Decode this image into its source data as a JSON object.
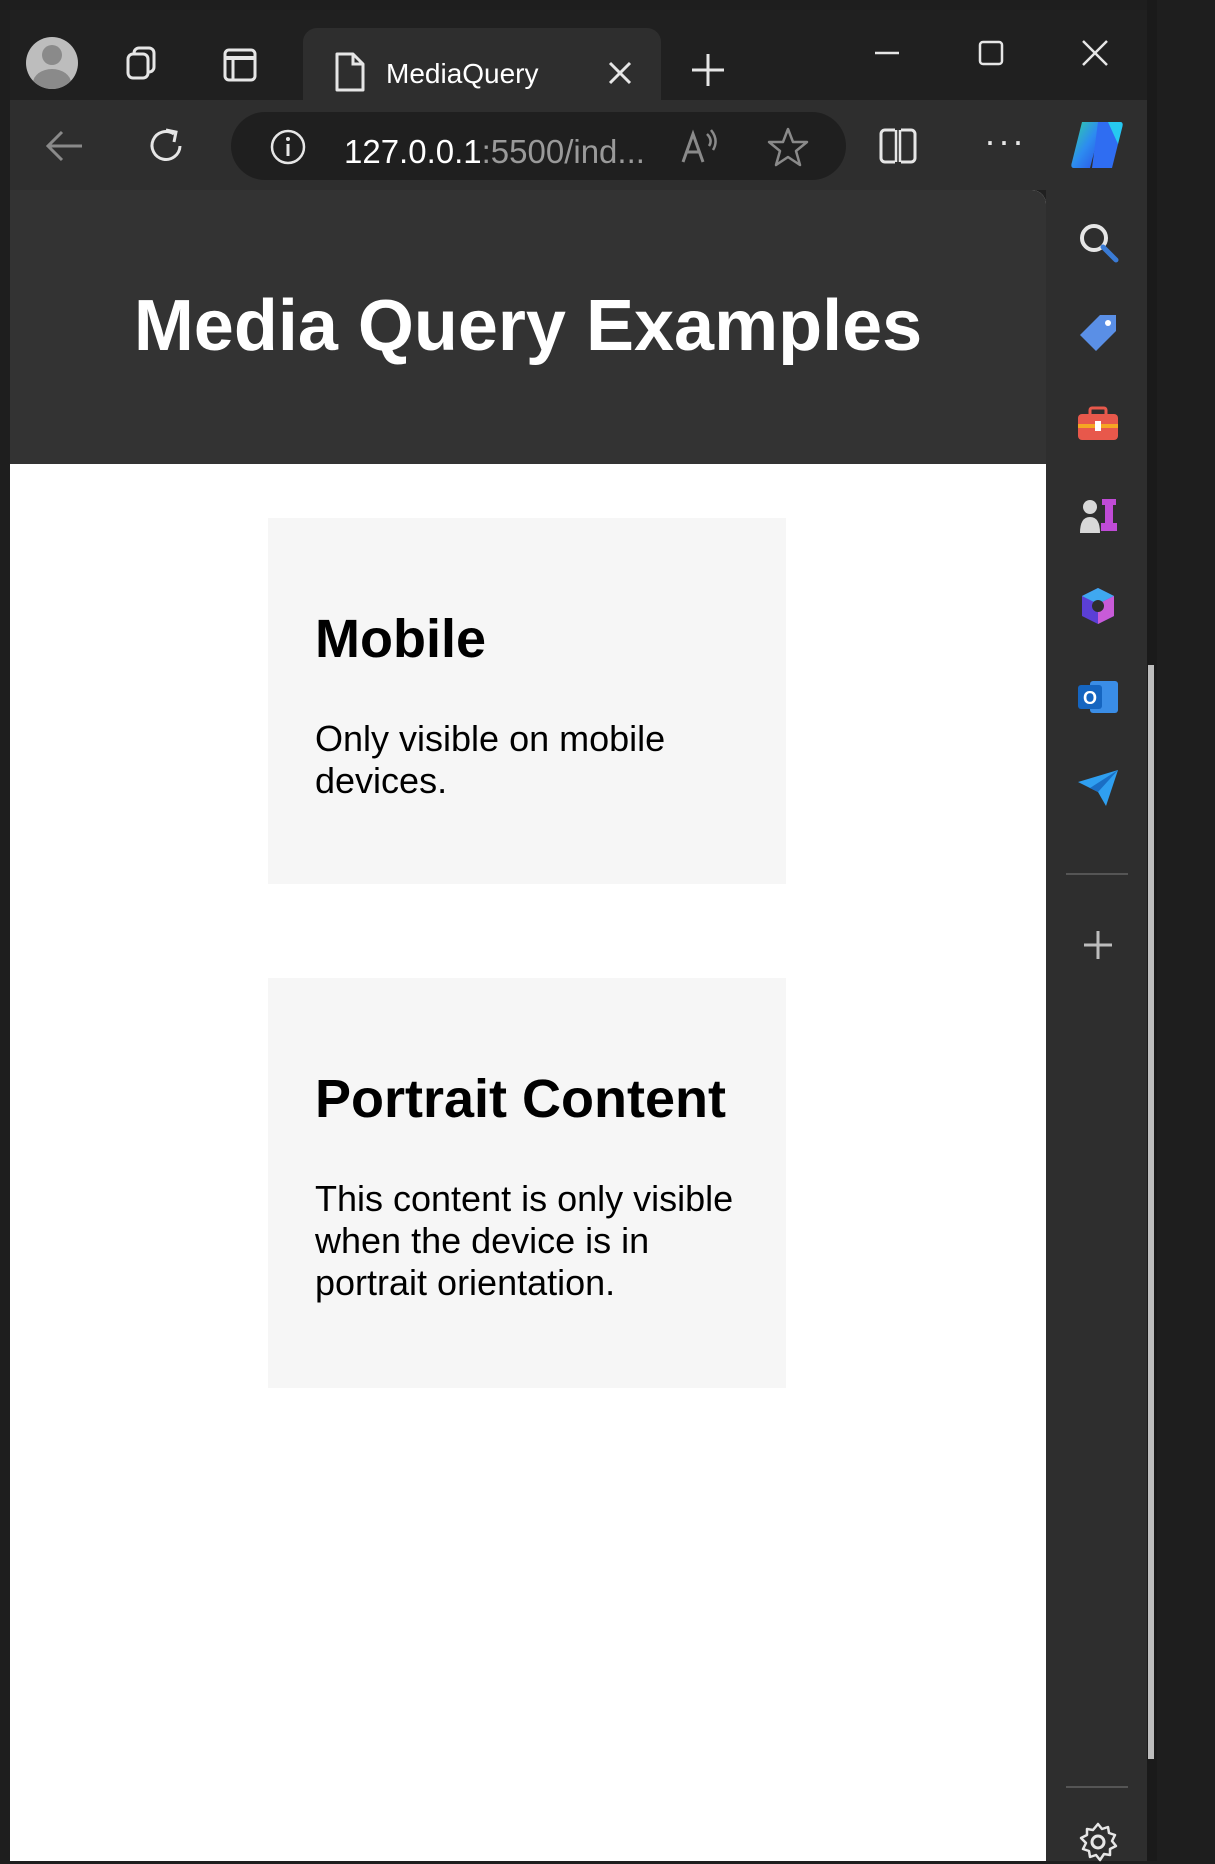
{
  "tab": {
    "title": "MediaQuery"
  },
  "address_bar": {
    "url_host": "127.0.0.1",
    "url_rest": ":5500/ind..."
  },
  "page": {
    "title": "Media Query Examples",
    "cards": [
      {
        "heading": "Mobile",
        "text": "Only visible on mobile devices."
      },
      {
        "heading": "Portrait Content",
        "text": "This content is only visible when the device is in portrait orientation."
      }
    ]
  },
  "colors": {
    "header_bg": "#333333",
    "card_bg": "#f6f6f6",
    "browser_chrome": "#2e2e2e"
  },
  "icons": {
    "tabbar": [
      "profile-avatar",
      "workspaces-icon",
      "tab-actions-icon",
      "page-icon",
      "close-icon",
      "new-tab-icon",
      "minimize-icon",
      "maximize-icon",
      "window-close-icon"
    ],
    "toolbar": [
      "back-icon",
      "refresh-icon",
      "info-icon",
      "read-aloud-icon",
      "favorite-star-icon",
      "split-screen-icon",
      "more-icon",
      "copilot-icon"
    ],
    "sidebar": [
      "search-icon",
      "shopping-tag-icon",
      "tools-icon",
      "games-icon",
      "microsoft365-icon",
      "outlook-icon",
      "send-icon",
      "add-icon",
      "settings-icon"
    ]
  }
}
